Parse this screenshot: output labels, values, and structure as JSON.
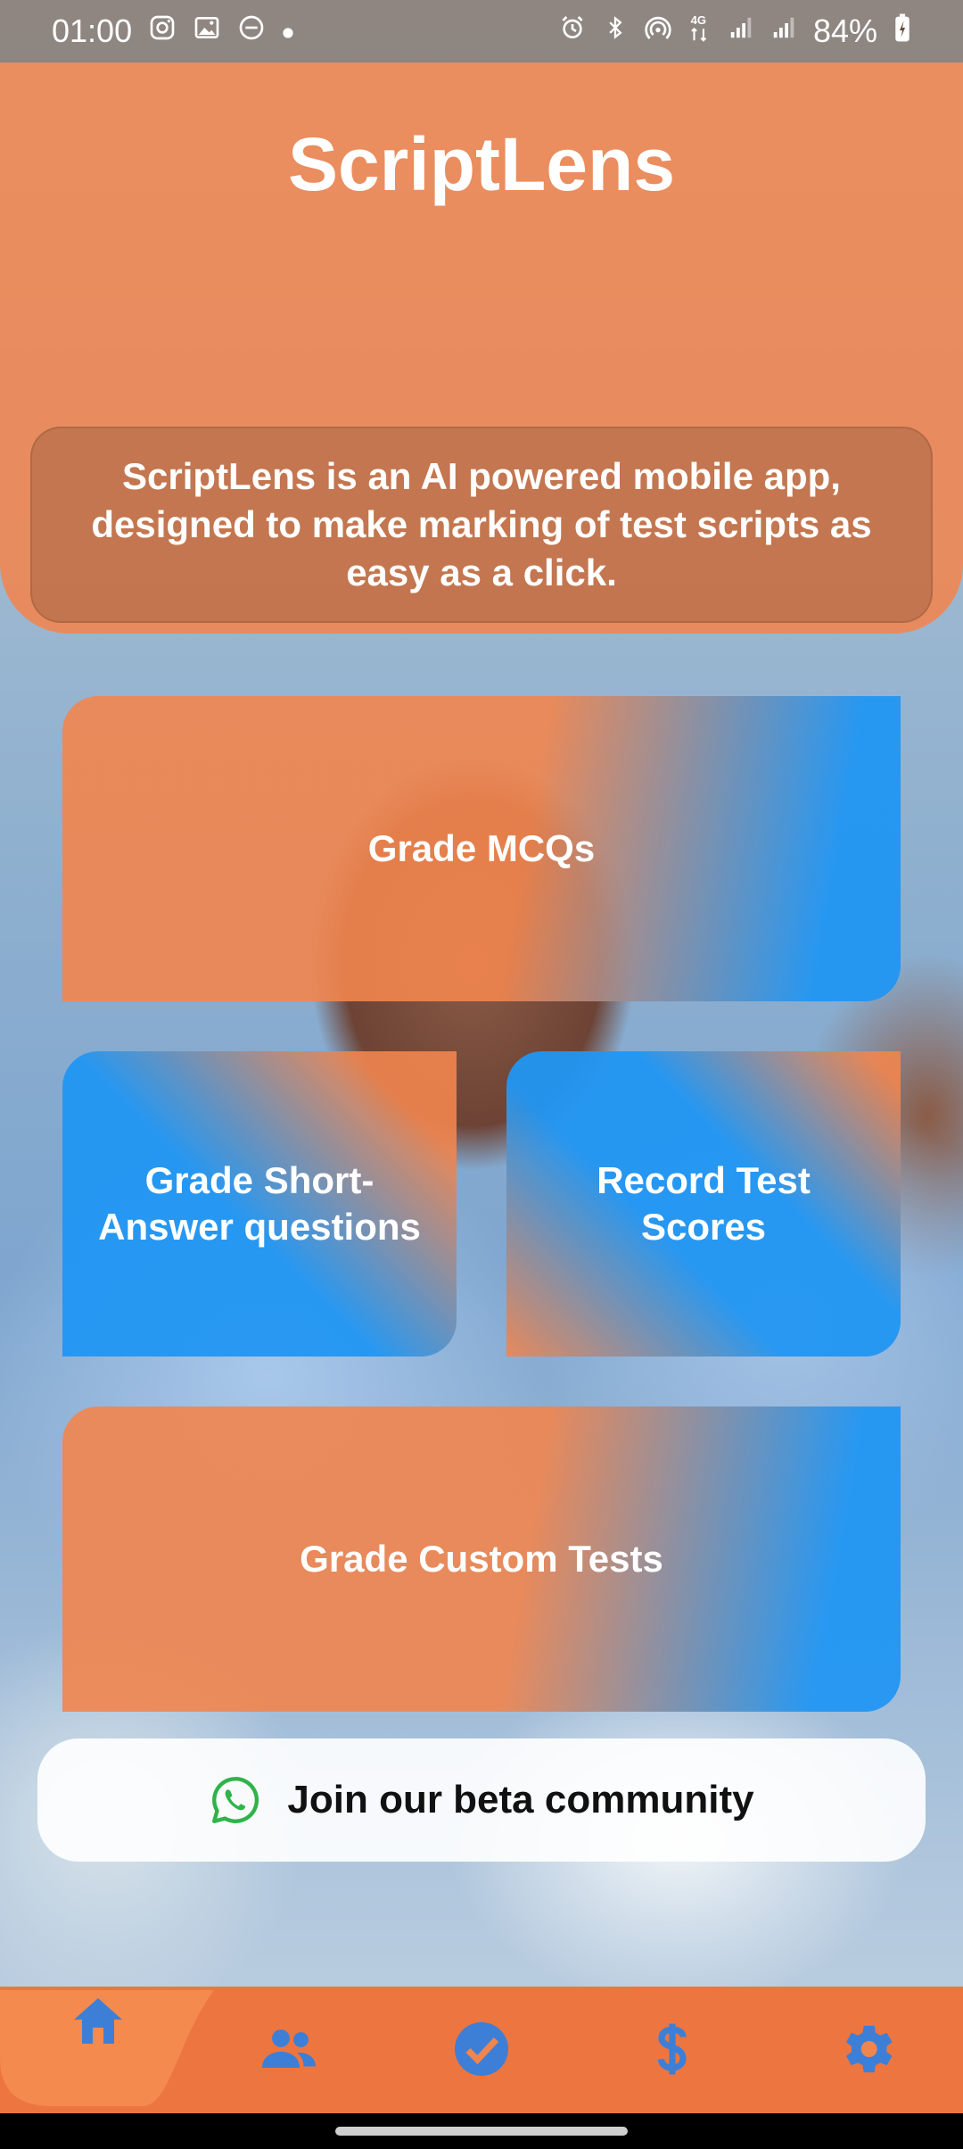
{
  "status_bar": {
    "time": "01:00",
    "battery": "84%",
    "left_icons": [
      "instagram-icon",
      "gallery-icon",
      "dnd-icon",
      "dot-icon"
    ],
    "right_icons": [
      "alarm-icon",
      "bluetooth-icon",
      "hotspot-icon",
      "data-4g-icon",
      "signal-icon",
      "signal-icon",
      "battery-icon"
    ]
  },
  "header": {
    "title": "ScriptLens",
    "description": "ScriptLens is an AI powered mobile app, designed to make marking of test scripts as easy as a click."
  },
  "tiles": {
    "mcq": "Grade MCQs",
    "short_answer": "Grade Short-Answer questions",
    "record_scores": "Record Test Scores",
    "custom_tests": "Grade Custom Tests"
  },
  "community": {
    "label": "Join our beta community",
    "icon": "whatsapp-icon"
  },
  "bottom_nav": {
    "items": [
      {
        "icon": "home-icon",
        "active": true
      },
      {
        "icon": "people-icon",
        "active": false
      },
      {
        "icon": "check-circle-icon",
        "active": false
      },
      {
        "icon": "dollar-icon",
        "active": false
      },
      {
        "icon": "gear-icon",
        "active": false
      }
    ]
  },
  "colors": {
    "orange": "#F1854E",
    "blue": "#2196F3",
    "nav_icon": "#3D7FD6",
    "whatsapp_green": "#2FB34A"
  }
}
